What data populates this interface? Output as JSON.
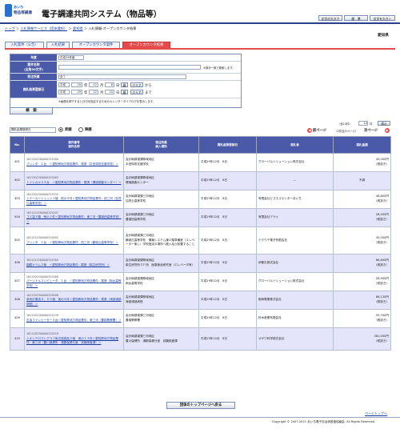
{
  "header": {
    "logo_top": "あいち",
    "logo_bottom": "物品等調達",
    "title": "電子調達共同システム（物品等）",
    "font_size_buttons": [
      "文字の大きさ",
      "標　準",
      "文字を大きく"
    ],
    "user": "愛知県"
  },
  "breadcrumb": {
    "items": [
      "トップ",
      "入札情報サービス（団体選択）",
      "愛知県",
      "入札情報-オープンカウンタ結果"
    ],
    "seps": [
      "＞",
      "＞",
      "＞"
    ]
  },
  "tabs": [
    {
      "label": "入札案件（公告）"
    },
    {
      "label": "入札結果"
    },
    {
      "label": "オープンカウンタ案件"
    },
    {
      "label": "オープンカウンタ結果"
    }
  ],
  "search": {
    "year_label": "年度",
    "year_value": "平成29年度",
    "case_name_label": "案件名称",
    "case_name_sub": "(全角50文字)",
    "case_name_note": "※部分一致で検索します。",
    "org_label": "発注所属",
    "org_value": "全て",
    "date_label": "開札結果登録日",
    "from": {
      "era": "平成",
      "year": "29",
      "month": "12",
      "day": "8",
      "year_unit": "年",
      "month_unit": "月",
      "day_unit": "日",
      "button": "暦",
      "clear": "クリア",
      "suffix": "から"
    },
    "to": {
      "era": "平成",
      "year": "29",
      "month": "12",
      "day": "15",
      "year_unit": "年",
      "month_unit": "月",
      "day_unit": "日",
      "button": "暦",
      "clear": "クリア",
      "suffix": "まで"
    },
    "date_note": "※画像を押下すると日付を指定するためのカレンダーダイアログを表示します。",
    "search_button": "検　索"
  },
  "sort": {
    "field": "開札結果登録日",
    "asc": "昇順",
    "desc": "降順"
  },
  "paging": {
    "total": "（全14件）",
    "per_page": "10",
    "per_unit": "件",
    "show": "表示",
    "prev": "前ページ",
    "page_info": "（1件目/2ページ）",
    "next": "次ページ"
  },
  "table": {
    "headers": {
      "no": "No.",
      "case_no": "案件番号",
      "case_name": "案件名称",
      "org": "発注所属",
      "delivery": "納入場所",
      "date": "開札結果登録日",
      "winner": "落札者",
      "amount": "落札金額"
    },
    "rows": [
      {
        "no": "401",
        "case_no": "1611302300000325300",
        "name": "プリンタ　１台　＜愛知県地方物品業件：尾張（半田特別支援学校）＞",
        "org": "会計局調達課県域地区",
        "place": "半田特別支援学校",
        "date": "平成29年12月　8日",
        "winner": "グローバルソリューション株式会社",
        "amount": "45,000円",
        "tax": "（税抜き）"
      },
      {
        "no": "402",
        "case_no": "1611302300000325263",
        "name": "トイレカメラ３台　＜愛知県地方物品業件：尾張（環境調査センター）＞",
        "org": "会計局調達課県域地区",
        "place": "環境調査センター",
        "date": "平成29年12月　8日",
        "winner": "---",
        "amount": "不調",
        "tax": ""
      },
      {
        "no": "403",
        "case_no": "1611302300000325335",
        "name": "トナーカートリッジ１個　他の４件＜愛知県地方物品業件：西三河（加茂丘高等学校）＞",
        "org": "会計局調達課三河地区",
        "place": "加茂丘高等学校",
        "date": "平成29年12月　8日",
        "winner": "有限会社ビズネスセンターあいち",
        "amount": "46,800円",
        "tax": "（税抜き）"
      },
      {
        "no": "404",
        "case_no": "1611252300000325207",
        "name": "ゴミ袋３箱　他の２件＜愛知県地方物品業件：東三河（豊橋西高等学校）＞",
        "org": "会計局調達課三河地区",
        "place": "豊橋西高等学校",
        "date": "平成29年12月　8日",
        "winner": "有限会社アライ",
        "amount": "28,000円",
        "tax": "（税抜き）"
      },
      {
        "no": "405",
        "case_no": "1611252300000325002",
        "name": "プリンタ　１台　＜愛知県地方物品業件：西三河（鶴城丘高等学校）＞",
        "org": "会計局調達課三河地区",
        "place": "鶴城丘高等学校　情報システム棟２階準備室（エレベーター無し）学校指定の場所へ搬入及び設置すること",
        "date": "平成29年12月　8日",
        "winner": "テクウチ電子有限会社",
        "amount": "35,000円",
        "tax": "（税抜き）"
      },
      {
        "no": "406",
        "case_no": "1611242300000324769",
        "name": "園鏡カラム２個　＜愛知県地方物品業件：尾張（衛生研究所）＞",
        "org": "会計局調達課県域地区",
        "place": "衛生研究所３Ｆ西　医薬食品研究室（エレベータ有）",
        "date": "平成29年12月　8日",
        "winner": "伊藤久株式会社",
        "amount": "66,600円",
        "tax": "（税抜き）"
      },
      {
        "no": "407",
        "case_no": "1611302300000325366",
        "name": "パーソナルコンピュータ　１台　＜愛知県地方物品業件：尾張（岡太高等学校）＞",
        "org": "会計局調達課県域地区",
        "place": "岡太高等学校",
        "date": "平成29年12月　8日",
        "winner": "グローバルソリューション株式会社",
        "amount": "28,900円",
        "tax": "（税抜き）"
      },
      {
        "no": "408",
        "case_no": "1611302300000325096",
        "name": "卓有灯電池４，００個　他の６件＜愛知県地方物品業件：尾張（海部浦部病院）＞",
        "org": "会計局調達課県域地区",
        "place": "海部浦部病院",
        "date": "平成29年12月　8日",
        "winner": "阪和電業株式会社",
        "amount": "86,120円",
        "tax": "（税抜き）"
      },
      {
        "no": "409",
        "case_no": "1611282300000325139",
        "name": "石油ファンヒーター３台＜愛知県地方物品業件：東三河（豊橋警察署）＞",
        "org": "会計局調達課三河地区",
        "place": "豊橋警察署",
        "date": "平成29年12月　8日",
        "winner": "鈴木産業有限会社",
        "amount": "59,700円",
        "tax": "（税抜き）"
      },
      {
        "no": "410",
        "case_no": "1611282300000325218",
        "name": "イオンクロマトグラフ用交換部品２個　他の１３件＜愛知県地方物品業件：東三河（豊川保健所　湯郡保健分室　試験検査課）＞",
        "org": "会計局調達課三河地区",
        "place": "豊川保健所　湯郡保健分室　試験検査課",
        "date": "平成29年12月　8日",
        "winner": "オザワ科学株式会社",
        "amount": "381,000円",
        "tax": "（税抜き）"
      }
    ]
  },
  "footer": {
    "back_button": "団体のトップページへ戻る",
    "page_top": "ページトップへ",
    "copyright": "Copyright © 2007-2021 あいち電子自治体推進協議会. All Rights Reserved."
  },
  "colors": {
    "header_blue": "#2b3f8f",
    "table_header": "#4a5aa8",
    "row_alt": "#e4e4fa",
    "active_tab": "#e64b4b"
  }
}
